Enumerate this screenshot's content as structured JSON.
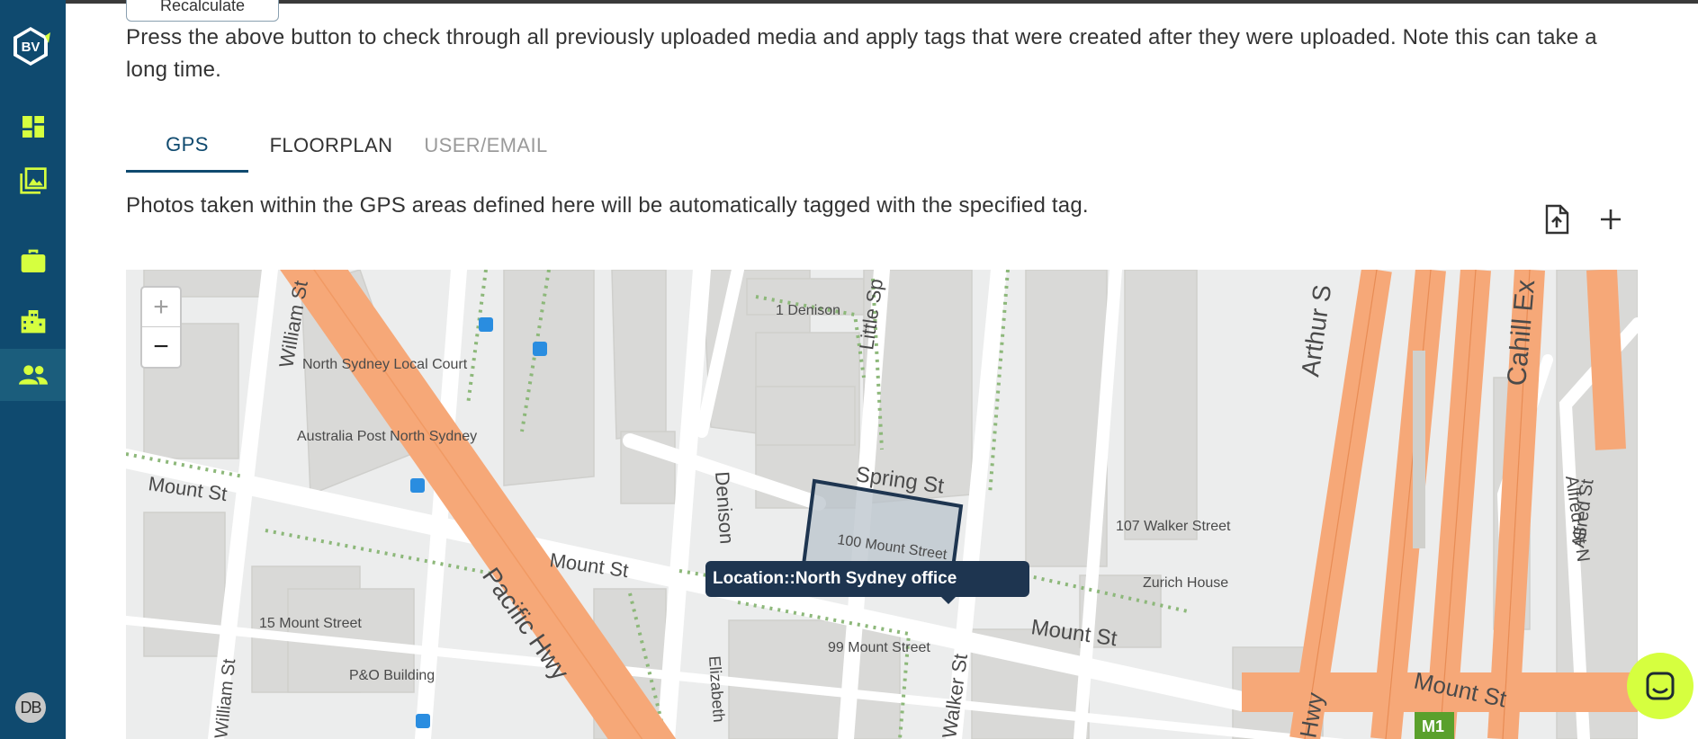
{
  "sidebar": {
    "logo_text": "BV",
    "items": [
      {
        "name": "dashboard",
        "active": false
      },
      {
        "name": "gallery",
        "active": false
      },
      {
        "name": "projects",
        "active": false
      },
      {
        "name": "buildings",
        "active": false
      },
      {
        "name": "users",
        "active": true
      }
    ],
    "avatar_initials": "DB"
  },
  "main": {
    "recalculate_label": "Recalculate",
    "description": "Press the above button to check through all previously uploaded media and apply tags that were created after they were uploaded. Note this can take a long time.",
    "tabs": [
      {
        "label": "GPS",
        "state": "active"
      },
      {
        "label": "FLOORPLAN",
        "state": "normal"
      },
      {
        "label": "USER/EMAIL",
        "state": "disabled"
      }
    ],
    "gps_description": "Photos taken within the GPS areas defined here will be automatically tagged with the specified tag.",
    "toolbar": {
      "import_icon": "file-upload-icon",
      "add_icon": "plus-icon"
    }
  },
  "map": {
    "zoom_in": "+",
    "zoom_out": "−",
    "tooltip": "Location::North Sydney office",
    "labels": {
      "william_st": "William St",
      "court": "North Sydney Local Court",
      "post": "Australia Post North Sydney",
      "mount_st_left": "Mount St",
      "mount_st_mid": "Mount St",
      "mount_st_right": "Mount St",
      "mount_st_far": "Mount St",
      "pacific_hwy": "Pacific Hwy",
      "denison": "1 Denison",
      "little_sp": "Little Sp",
      "spring_st": "Spring St",
      "denison_st": "Denison",
      "mount_100": "100 Mount Street",
      "walker_107": "107 Walker Street",
      "zurich": "Zurich House",
      "arthur_st": "Arthur S",
      "cahill": "Cahill Ex",
      "alfred_st": "Alfred St",
      "alfred_st_n": "Alfred St N",
      "mount_15": "15 Mount Street",
      "po_building": "P&O Building",
      "mount_99": "99 Mount Street",
      "elizabeth": "Elizabeth",
      "walker_st": "Walker St",
      "william_st_bottom": "William St",
      "hwy": "Hwy",
      "m1": "M1"
    }
  },
  "colors": {
    "sidebar": "#0f4a6f",
    "accent": "#d6ff3f",
    "motorway": "#f6a878",
    "tooltip": "#1e3550"
  }
}
